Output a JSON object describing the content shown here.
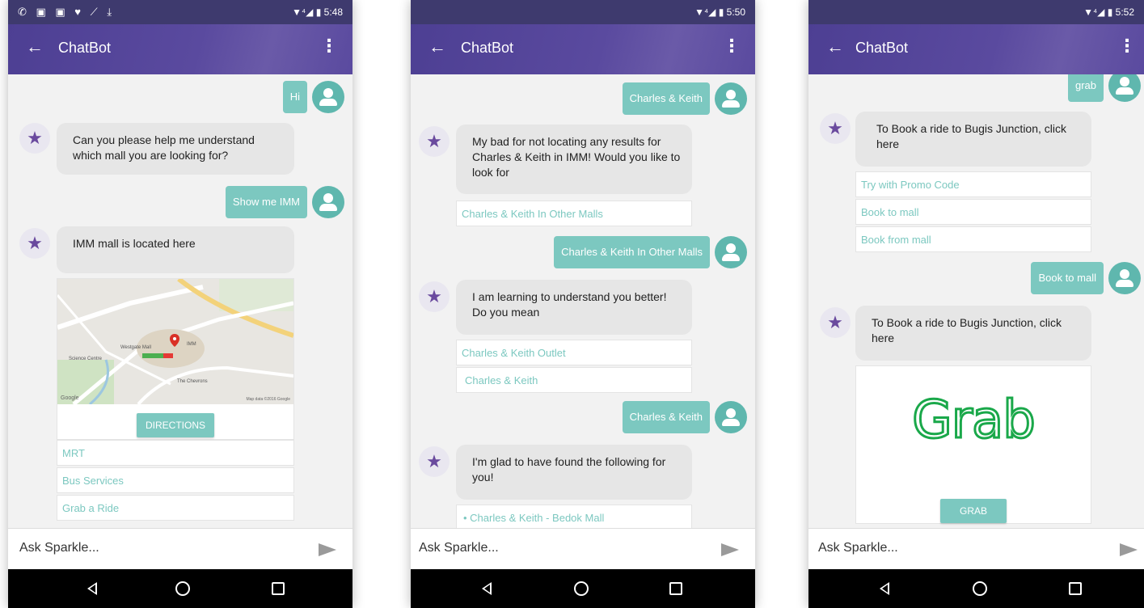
{
  "colors": {
    "accent": "#7cc8c0",
    "appbar": "#4d3f93",
    "grab": "#1aa84a"
  },
  "screens": [
    {
      "status": {
        "left_icons": "✆ ▣ ▣ ♥ ⟋ ⤓",
        "right": "▼⁴◢ ▮ 5:48"
      },
      "appbar": {
        "back_icon": "←",
        "title": "ChatBot",
        "menu_icon": "⋮"
      },
      "messages": {
        "u1": "Hi",
        "b1": "Can you please help me understand which mall you are looking for?",
        "u2": "Show me IMM",
        "b2": "IMM mall is located here"
      },
      "map": {
        "lbl_westgate": "Westgate Mall",
        "lbl_imm": "IMM",
        "lbl_science": "Science Centre",
        "lbl_chevrons": "The Chevrons",
        "lbl_google": "Google",
        "lbl_mapdata": "Map data ©2016 Google"
      },
      "directions": "DIRECTIONS",
      "options": [
        "MRT",
        "Bus Services",
        "Grab a Ride"
      ],
      "input_placeholder": "Ask Sparkle...",
      "bot_icon": "★"
    },
    {
      "status": {
        "left_icons": "",
        "right": "▼⁴◢ ▮ 5:50"
      },
      "appbar": {
        "back_icon": "←",
        "title": "ChatBot",
        "menu_icon": "⋮"
      },
      "messages": {
        "u1": "Charles & Keith",
        "b1": "My bad for not locating any results for Charles & Keith in IMM! Would you like to look for",
        "u2": "Charles & Keith In Other Malls",
        "b2": "I am learning to understand you better! Do you mean",
        "u3": "Charles & Keith",
        "b3": "I'm glad to have found the following for you!"
      },
      "options1": [
        "Charles & Keith In Other Malls"
      ],
      "options2": [
        "Charles & Keith Outlet",
        "Charles & Keith"
      ],
      "options3": [
        "• Charles & Keith - Bedok Mall"
      ],
      "input_placeholder": "Ask Sparkle...",
      "bot_icon": "★"
    },
    {
      "status": {
        "left_icons": "",
        "right": "▼⁴◢ ▮ 5:52"
      },
      "appbar": {
        "back_icon": "←",
        "title": "ChatBot",
        "menu_icon": "⋮"
      },
      "messages": {
        "u1": "grab",
        "b1": "To Book a ride to Bugis Junction, click here",
        "u2": "Book to mall",
        "b2": "To Book a ride to Bugis Junction, click here"
      },
      "options": [
        "Try with Promo Code",
        "Book to mall",
        "Book from mall"
      ],
      "grab_logo": "Grab",
      "grab_button": "GRAB",
      "input_placeholder": "Ask Sparkle...",
      "bot_icon": "★"
    }
  ]
}
